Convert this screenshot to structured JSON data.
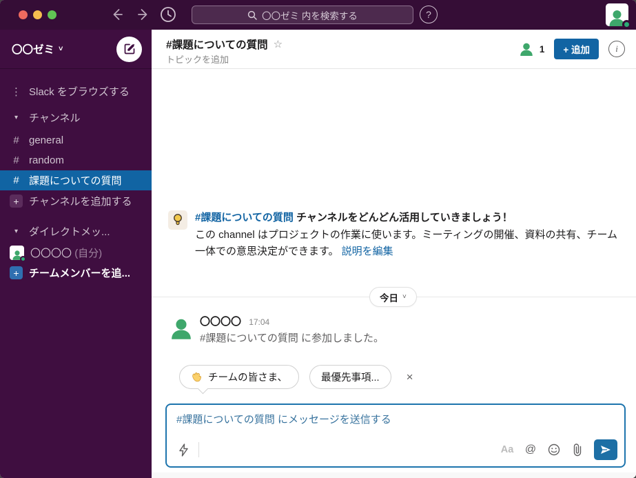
{
  "window": {
    "search_placeholder": "〇〇ゼミ 内を検索する",
    "help_glyph": "?"
  },
  "sidebar": {
    "workspace_name": "〇〇ゼミ",
    "workspace_chevron": "˅",
    "browse_label": "Slack をブラウズする",
    "browse_glyph": "⋮",
    "channels_header": "チャンネル",
    "channels": [
      {
        "label": "general"
      },
      {
        "label": "random"
      },
      {
        "label": "課題についての質問"
      }
    ],
    "hash_glyph": "#",
    "plus_glyph": "+",
    "triangle_glyph": "▾",
    "add_channel_label": "チャンネルを追加する",
    "dm_header": "ダイレクトメッ...",
    "dm_user": "〇〇〇〇",
    "dm_user_suffix": "(自分)",
    "add_member_label": "チームメンバーを追..."
  },
  "header": {
    "channel_title": "#課題についての質問",
    "star_glyph": "☆",
    "topic_label": "トピックを追加",
    "member_count": "1",
    "add_button_label": "+ 追加",
    "info_glyph": "i"
  },
  "intro": {
    "title_link": "#課題についての質問",
    "title_rest": " チャンネルをどんどん活用していきましょう！",
    "body_text": "この channel はプロジェクトの作業に使います。ミーティングの開催、資料の共有、チーム一体での意思決定ができます。 ",
    "edit_link": "説明を編集"
  },
  "date_divider": {
    "label": "今日",
    "chevron": "˅"
  },
  "message": {
    "author": "〇〇〇〇",
    "time": "17:04",
    "body": "#課題についての質問 に参加しました。"
  },
  "suggestions": {
    "chip1_label": "チームの皆さま、",
    "chip2_label": "最優先事項...",
    "close_glyph": "×"
  },
  "composer": {
    "placeholder": "#課題についての質問 にメッセージを送信する",
    "format_label": "Aa",
    "mention_glyph": "@"
  },
  "colors": {
    "topbar": "#350d36",
    "sidebar": "#3f0e40",
    "selected_channel": "#1164a3",
    "link_blue": "#1264a3",
    "composer_border": "#1d74ad",
    "send_button": "#1d6fa5",
    "avatar_green": "#3ea76b",
    "presence_green": "#2bac76"
  }
}
